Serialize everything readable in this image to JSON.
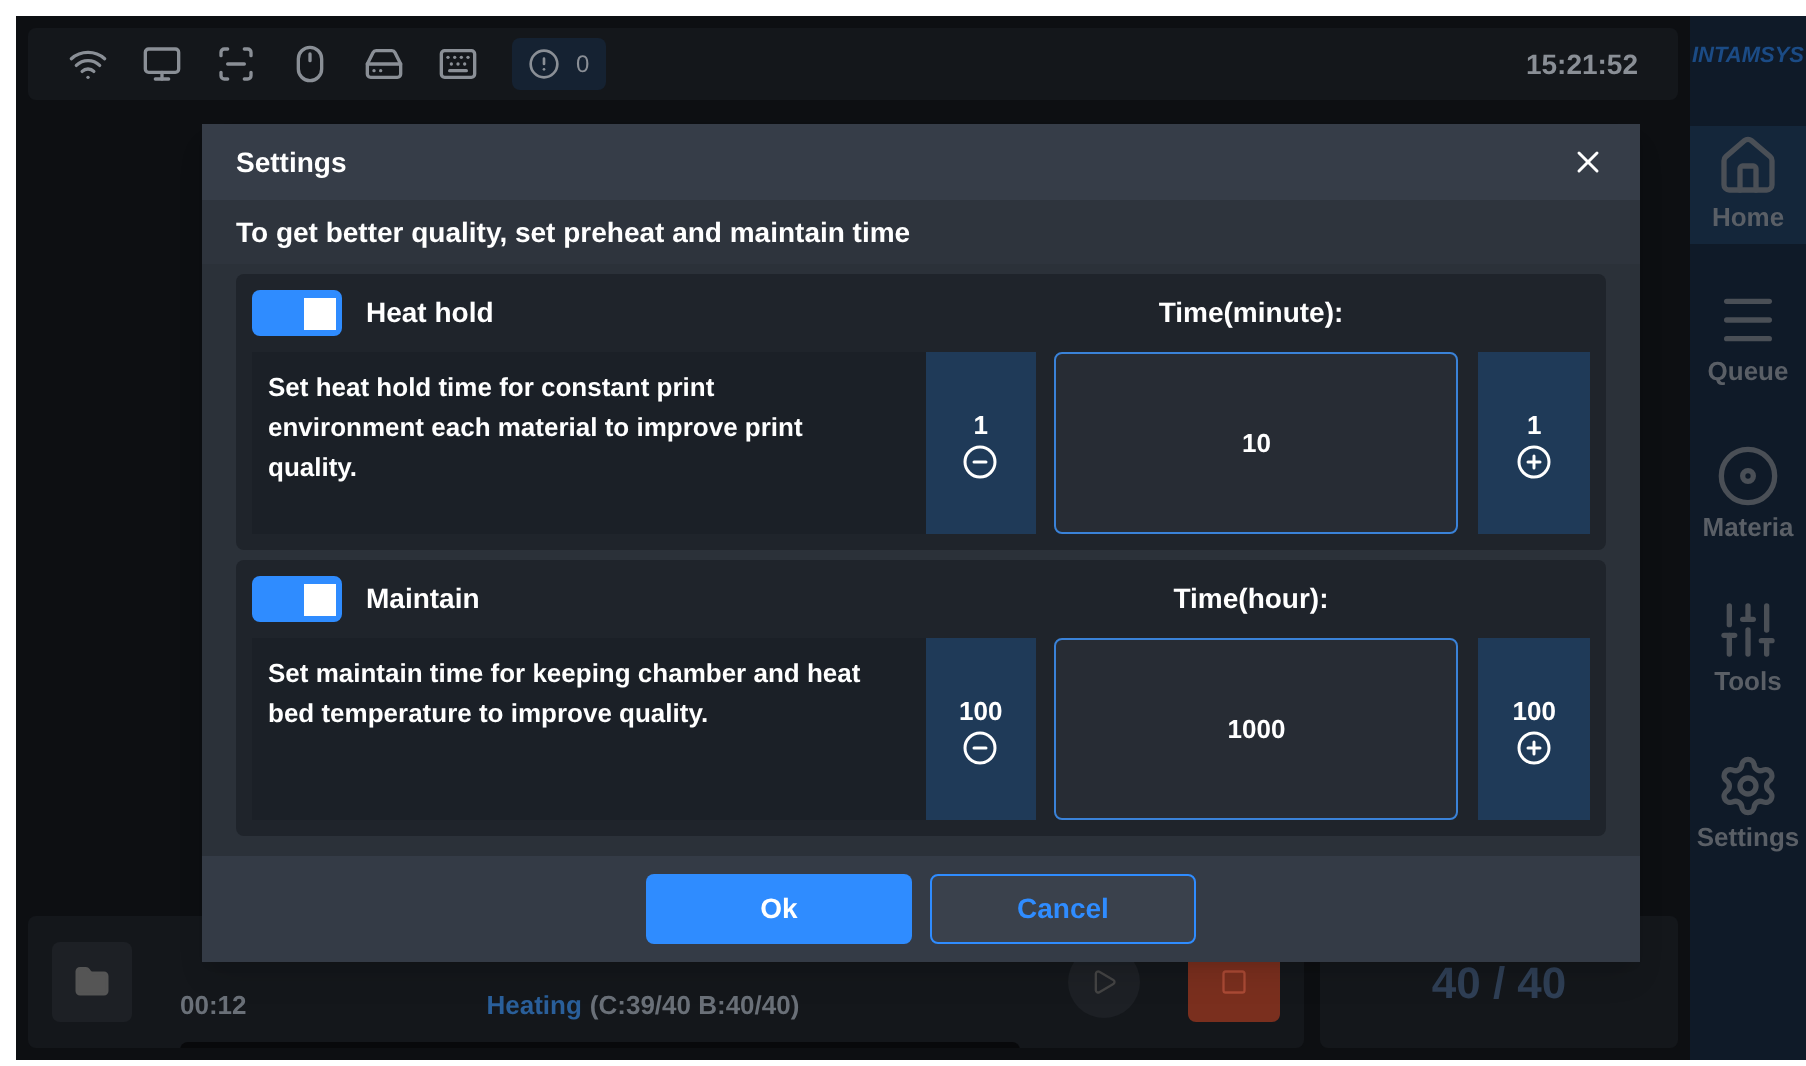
{
  "status_bar": {
    "alert_count": "0",
    "time": "15:21:52"
  },
  "brand": "INTAMSYS",
  "sidebar": {
    "items": [
      {
        "label": "Home",
        "kind": "home",
        "selected": true
      },
      {
        "label": "Queue",
        "kind": "queue",
        "selected": false
      },
      {
        "label": "Materia",
        "kind": "material",
        "selected": false
      },
      {
        "label": "Tools",
        "kind": "tools",
        "selected": false
      },
      {
        "label": "Settings",
        "kind": "settings",
        "selected": false
      }
    ]
  },
  "job": {
    "elapsed": "00:12",
    "status": "Heating",
    "detail": "(C:39/40 B:40/40)",
    "layers": "40 / 40"
  },
  "dialog": {
    "title": "Settings",
    "subtitle": "To get better quality, set preheat and maintain time",
    "sections": [
      {
        "title": "Heat hold",
        "on": true,
        "time_label": "Time(minute):",
        "description": "Set  heat hold time for  constant print environment each material to improve print quality.",
        "decrement": "1",
        "value": "10",
        "increment": "1"
      },
      {
        "title": "Maintain",
        "on": true,
        "time_label": "Time(hour):",
        "description": "Set maintain time for keeping chamber and heat bed temperature to improve quality.",
        "decrement": "100",
        "value": "1000",
        "increment": "100"
      }
    ],
    "buttons": [
      {
        "label": "Ok",
        "kind": "primary"
      },
      {
        "label": "Cancel",
        "kind": "secondary"
      }
    ]
  }
}
